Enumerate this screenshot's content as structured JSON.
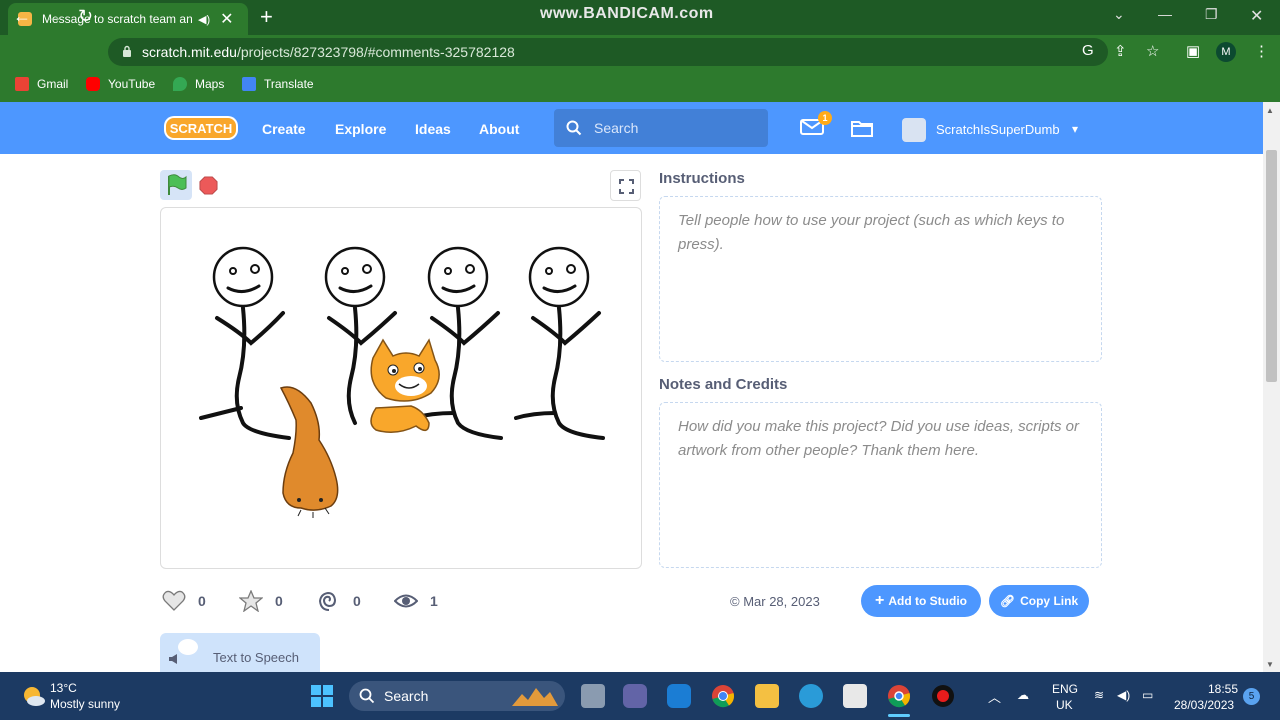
{
  "browser": {
    "tab_title": "Message to scratch team and",
    "new_tab": "+",
    "watermark": "www.BANDICAM.com",
    "url_host": "scratch.mit.edu",
    "url_path": "/projects/827323798/#comments-325782128",
    "profile_initial": "M",
    "bookmarks": [
      "Gmail",
      "YouTube",
      "Maps",
      "Translate"
    ]
  },
  "scratch_header": {
    "logo_text": "SCRATCH",
    "nav": [
      "Create",
      "Explore",
      "Ideas",
      "About"
    ],
    "search_placeholder": "Search",
    "message_count": "1",
    "username": "ScratchIsSuperDumb"
  },
  "project": {
    "instructions_title": "Instructions",
    "instructions_placeholder": "Tell people how to use your project (such as which keys to press).",
    "notes_title": "Notes and Credits",
    "notes_placeholder": "How did you make this project? Did you use ideas, scripts or artwork from other people? Thank them here.",
    "stats": {
      "loves": "0",
      "favorites": "0",
      "remixes": "0",
      "views": "1"
    },
    "date": "Mar 28, 2023",
    "add_to_studio": "Add to Studio",
    "copy_link": "Copy Link",
    "text_to_speech": "Text to Speech"
  },
  "taskbar": {
    "temperature": "13°C",
    "weather": "Mostly sunny",
    "search_label": "Search",
    "language_line1": "ENG",
    "language_line2": "UK",
    "time": "18:55",
    "date": "28/03/2023",
    "notification_count": "5"
  },
  "colors": {
    "scratch_blue": "#4d97ff",
    "chrome_green": "#2d7a2d",
    "taskbar": "#1c3a63"
  }
}
